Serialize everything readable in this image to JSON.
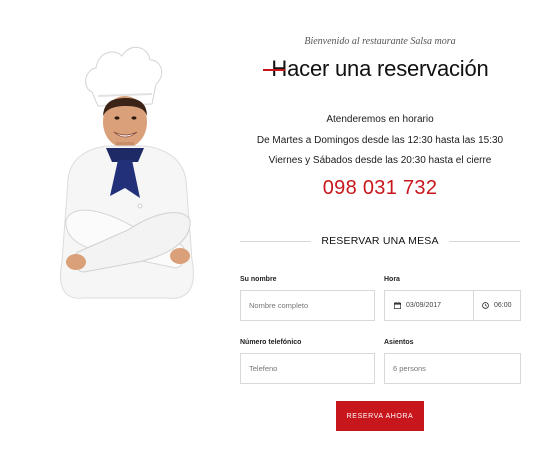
{
  "hero": {
    "welcome": "Bienvenido al restaurante Salsa mora",
    "title": "Hacer una reservación",
    "hours_line1": "Atenderemos en horario",
    "hours_line2": "De Martes a Domingos desde las 12:30 hasta las 15:30",
    "hours_line3": "Viernes y Sábados desde las 20:30 hasta el cierre",
    "phone": "098 031 732",
    "image": "chef-portrait",
    "accent_color": "#c8161d"
  },
  "form": {
    "heading": "RESERVAR UNA MESA",
    "name_label": "Su nombre",
    "name_placeholder": "Nombre completo",
    "time_label": "Hora",
    "date_value": "03/09/2017",
    "time_value": "06:00",
    "phone_label": "Número telefónico",
    "phone_placeholder": "Telefeno",
    "seats_label": "Asientos",
    "seats_placeholder": "6 persons",
    "submit_label": "RESERVA AHORA",
    "date_icon": "calendar-icon",
    "time_icon": "clock-icon"
  }
}
